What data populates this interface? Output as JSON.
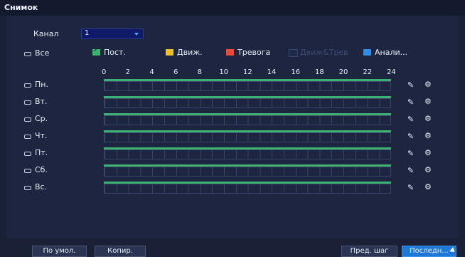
{
  "window": {
    "title": "Снимок"
  },
  "channel": {
    "label": "Канал",
    "value": "1"
  },
  "legend": {
    "all": "Все",
    "items": [
      {
        "label": "Пост.",
        "color": "#3cb371",
        "checked": true,
        "dim": false
      },
      {
        "label": "Движ.",
        "color": "#f0c020",
        "checked": false,
        "dim": false
      },
      {
        "label": "Тревога",
        "color": "#e84a3c",
        "checked": false,
        "dim": false
      },
      {
        "label": "Движ&Трев",
        "color": "#1e2a4a",
        "checked": false,
        "dim": true
      },
      {
        "label": "Анали...",
        "color": "#2a90e8",
        "checked": false,
        "dim": false
      }
    ]
  },
  "hours": [
    "0",
    "2",
    "4",
    "6",
    "8",
    "10",
    "12",
    "14",
    "16",
    "18",
    "20",
    "22",
    "24"
  ],
  "days": [
    "Пн.",
    "Вт.",
    "Ср.",
    "Чт.",
    "Пт.",
    "Сб.",
    "Вс."
  ],
  "buttons": {
    "default": "По умол.",
    "copy": "Копир.",
    "prev": "Пред. шаг",
    "next": "Последн..."
  }
}
